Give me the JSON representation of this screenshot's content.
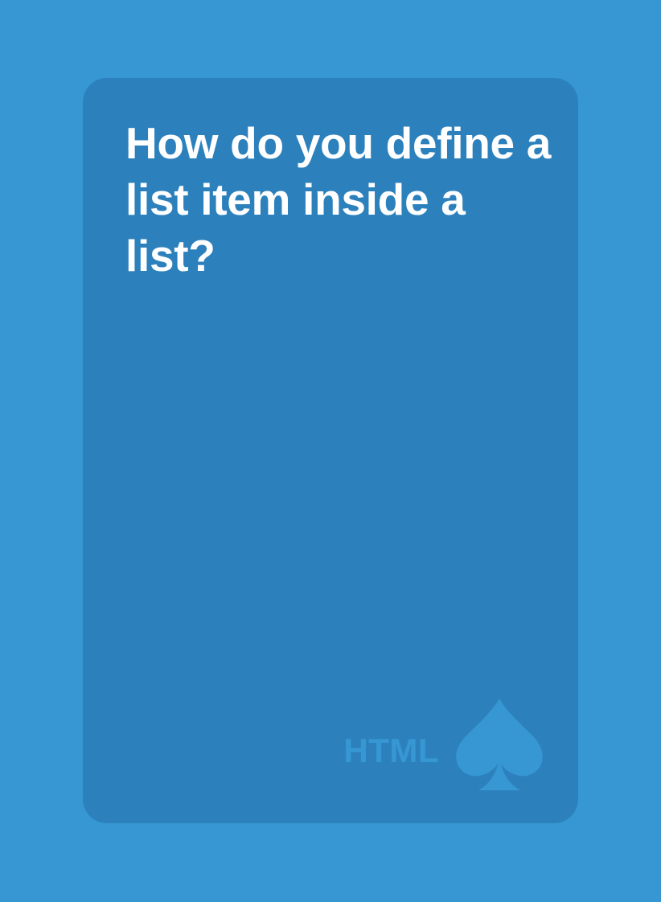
{
  "card": {
    "question": "How do you define a list item inside a list?",
    "category": "HTML",
    "suit_icon": "spade-icon"
  },
  "colors": {
    "background": "#3797d3",
    "card": "#2c81bd",
    "question_text": "#ffffff",
    "category_text": "#3797d3",
    "suit": "#3797d3"
  }
}
